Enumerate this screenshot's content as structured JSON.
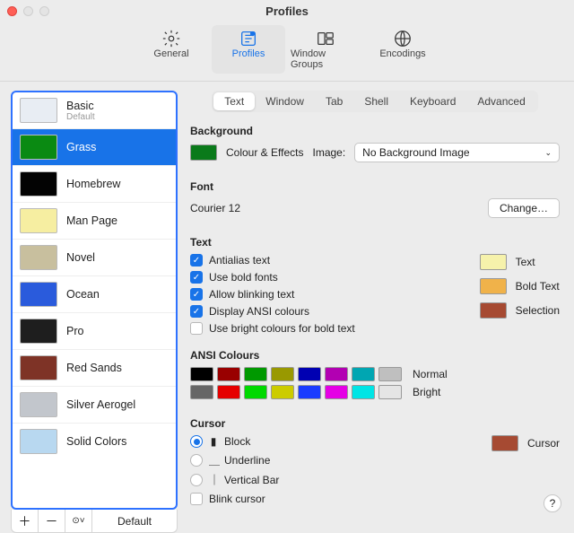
{
  "window_title": "Profiles",
  "toolbar": [
    {
      "key": "general",
      "label": "General"
    },
    {
      "key": "profiles",
      "label": "Profiles",
      "selected": true
    },
    {
      "key": "window-groups",
      "label": "Window Groups"
    },
    {
      "key": "encodings",
      "label": "Encodings"
    }
  ],
  "profiles": [
    {
      "name": "Basic",
      "sub": "Default",
      "thumb": "#e8edf3"
    },
    {
      "name": "Grass",
      "selected": true,
      "thumb": "#0a8a12"
    },
    {
      "name": "Homebrew",
      "thumb": "#030303"
    },
    {
      "name": "Man Page",
      "thumb": "#f6eea1"
    },
    {
      "name": "Novel",
      "thumb": "#c8bf9e"
    },
    {
      "name": "Ocean",
      "thumb": "#2a5bdc"
    },
    {
      "name": "Pro",
      "thumb": "#1e1e1e"
    },
    {
      "name": "Red Sands",
      "thumb": "#7e3326"
    },
    {
      "name": "Silver Aerogel",
      "thumb": "#c2c6cc"
    },
    {
      "name": "Solid Colors",
      "thumb": "#b8d8f0"
    }
  ],
  "sidebar_footer": {
    "add": "＋",
    "remove": "－",
    "menu": "⊙",
    "default_label": "Default"
  },
  "tabs": [
    "Text",
    "Window",
    "Tab",
    "Shell",
    "Keyboard",
    "Advanced"
  ],
  "active_tab": "Text",
  "background": {
    "section": "Background",
    "swatch": "#0a7a1a",
    "label": "Colour & Effects",
    "image_label": "Image:",
    "select_value": "No Background Image"
  },
  "font": {
    "section": "Font",
    "value": "Courier 12",
    "change": "Change…"
  },
  "text": {
    "section": "Text",
    "options": [
      {
        "label": "Antialias text",
        "checked": true
      },
      {
        "label": "Use bold fonts",
        "checked": true
      },
      {
        "label": "Allow blinking text",
        "checked": true
      },
      {
        "label": "Display ANSI colours",
        "checked": true
      },
      {
        "label": "Use bright colours for bold text",
        "checked": false
      }
    ],
    "swatches": [
      {
        "color": "#f6f2ab",
        "label": "Text"
      },
      {
        "color": "#f0b24a",
        "label": "Bold Text"
      },
      {
        "color": "#a64a32",
        "label": "Selection"
      }
    ]
  },
  "ansi": {
    "section": "ANSI Colours",
    "normal": {
      "label": "Normal",
      "colors": [
        "#000000",
        "#990000",
        "#009900",
        "#999900",
        "#0000b2",
        "#b200b2",
        "#00a6b2",
        "#bfbfbf"
      ]
    },
    "bright": {
      "label": "Bright",
      "colors": [
        "#666666",
        "#e50000",
        "#00d900",
        "#cccc00",
        "#1a3cff",
        "#e500e5",
        "#00e5e5",
        "#e5e5e5"
      ]
    }
  },
  "cursor": {
    "section": "Cursor",
    "options": [
      {
        "glyph": "▮",
        "label": "Block",
        "checked": true
      },
      {
        "glyph": "＿",
        "label": "Underline",
        "checked": false
      },
      {
        "glyph": "｜",
        "label": "Vertical Bar",
        "checked": false
      }
    ],
    "swatch": {
      "color": "#a64a32",
      "label": "Cursor"
    },
    "blink": {
      "label": "Blink cursor",
      "checked": false
    }
  },
  "help": "?"
}
